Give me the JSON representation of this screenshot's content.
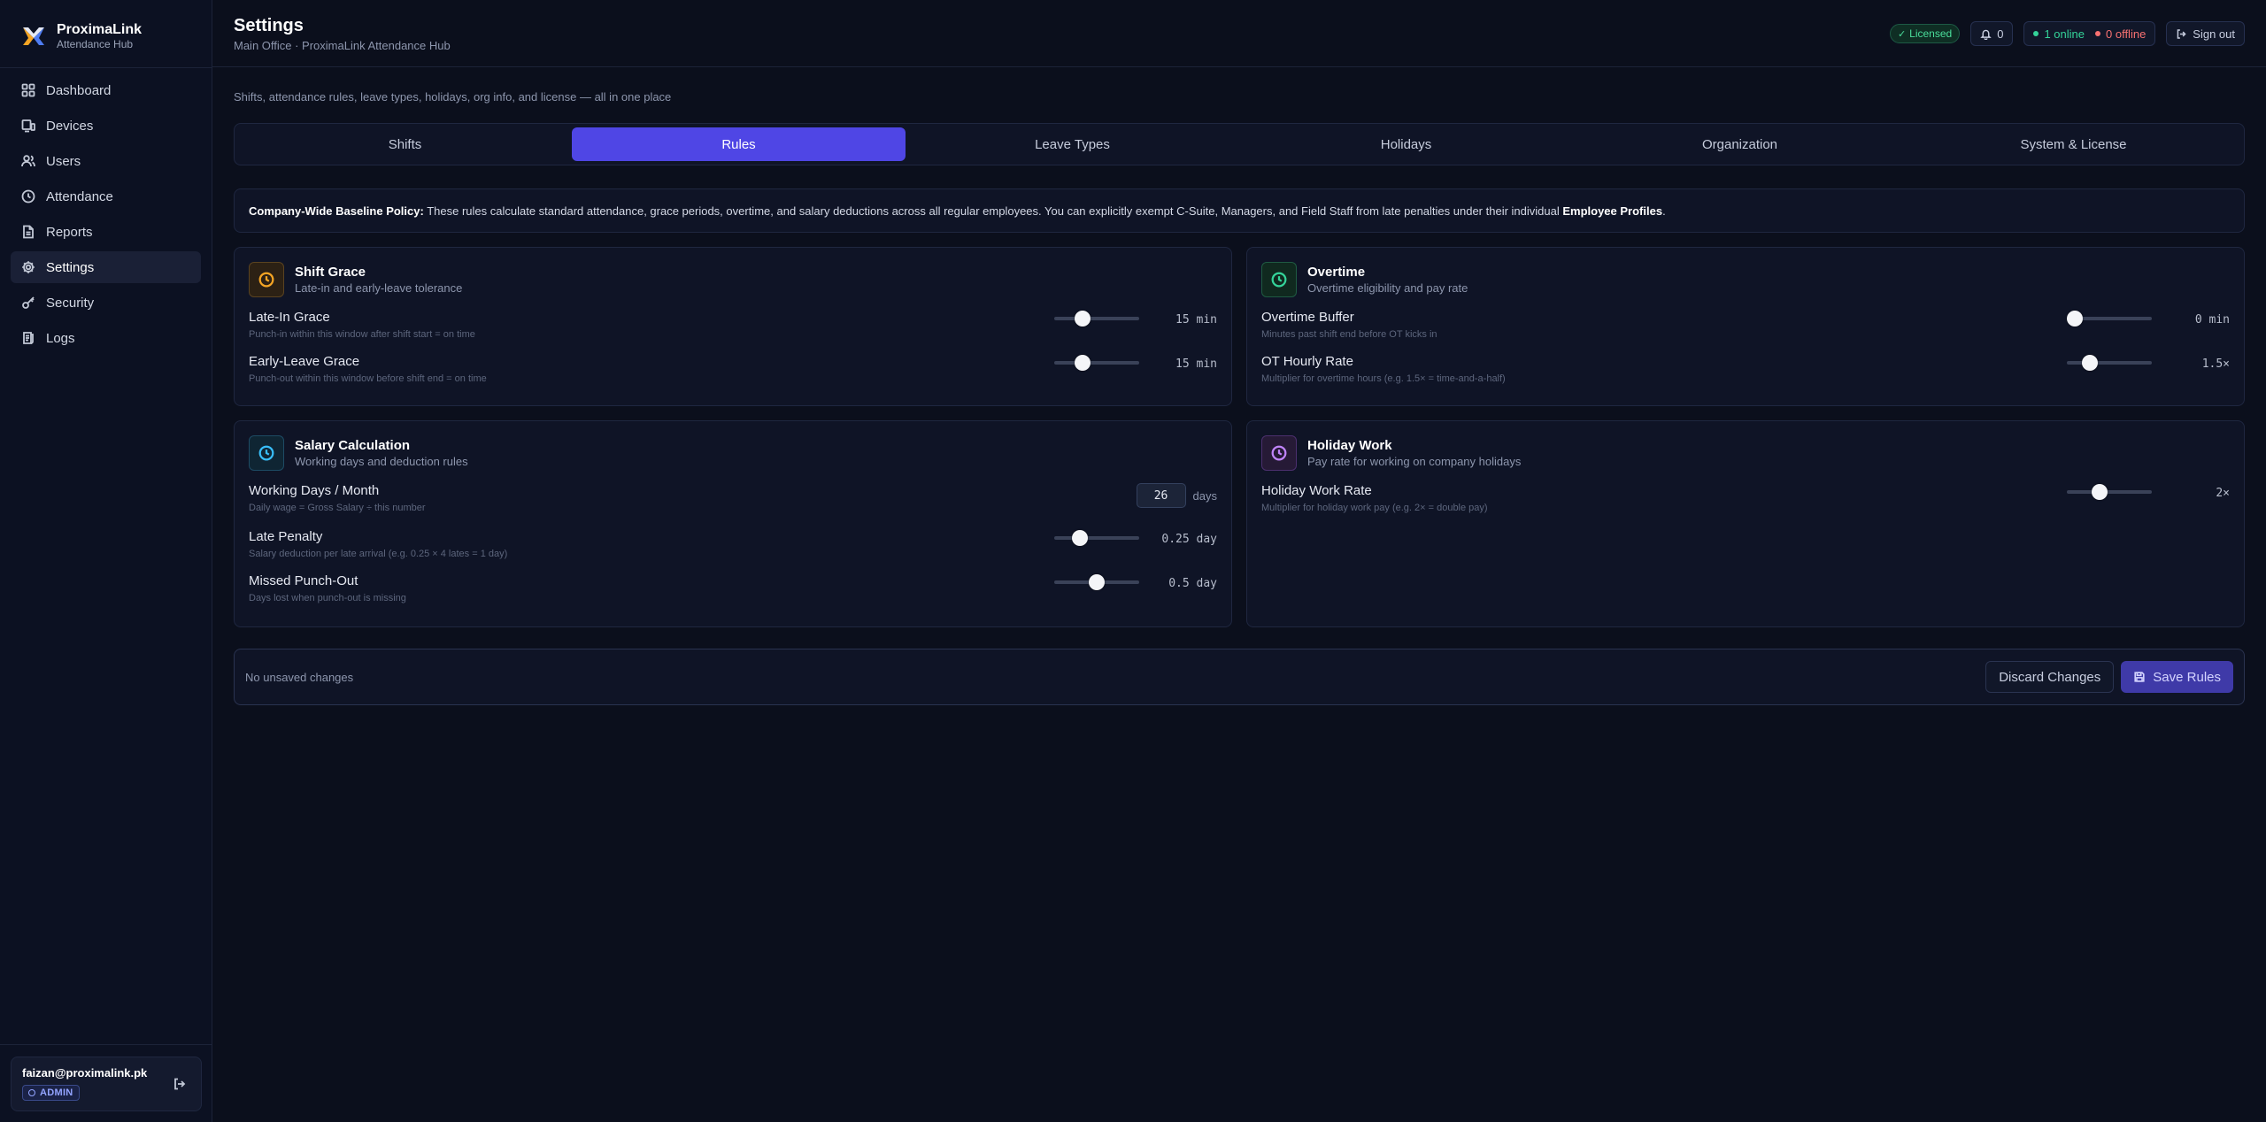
{
  "brand": {
    "name": "ProximaLink",
    "subtitle": "Attendance Hub"
  },
  "nav": [
    {
      "label": "Dashboard",
      "icon": "grid-icon"
    },
    {
      "label": "Devices",
      "icon": "device-icon"
    },
    {
      "label": "Users",
      "icon": "users-icon"
    },
    {
      "label": "Attendance",
      "icon": "clock-icon"
    },
    {
      "label": "Reports",
      "icon": "file-icon"
    },
    {
      "label": "Settings",
      "icon": "gear-icon",
      "active": true
    },
    {
      "label": "Security",
      "icon": "key-icon"
    },
    {
      "label": "Logs",
      "icon": "logs-icon"
    }
  ],
  "user": {
    "email": "faizan@proximalink.pk",
    "role": "ADMIN"
  },
  "header": {
    "title": "Settings",
    "subtitle": "Main Office · ProximaLink Attendance Hub",
    "license": "Licensed",
    "notifications": "0",
    "online": "1 online",
    "offline": "0 offline",
    "signout": "Sign out"
  },
  "description": "Shifts, attendance rules, leave types, holidays, org info, and license — all in one place",
  "tabs": [
    {
      "label": "Shifts"
    },
    {
      "label": "Rules",
      "active": true
    },
    {
      "label": "Leave Types"
    },
    {
      "label": "Holidays"
    },
    {
      "label": "Organization"
    },
    {
      "label": "System & License"
    }
  ],
  "policy": {
    "lead": "Company-Wide Baseline Policy:",
    "text": " These rules calculate standard attendance, grace periods, overtime, and salary deductions across all regular employees. You can explicitly exempt C-Suite, Managers, and Field Staff from late penalties under their individual ",
    "link": "Employee Profiles",
    "tail": "."
  },
  "cards": {
    "shift_grace": {
      "title": "Shift Grace",
      "subtitle": "Late-in and early-leave tolerance",
      "accent": "#f5a524",
      "rows": [
        {
          "label": "Late-In Grace",
          "help": "Punch-in within this window after shift start = on time",
          "value": "15 min",
          "fraction": 0.3
        },
        {
          "label": "Early-Leave Grace",
          "help": "Punch-out within this window before shift end = on time",
          "value": "15 min",
          "fraction": 0.3
        }
      ]
    },
    "overtime": {
      "title": "Overtime",
      "subtitle": "Overtime eligibility and pay rate",
      "accent": "#34d399",
      "rows": [
        {
          "label": "Overtime Buffer",
          "help": "Minutes past shift end before OT kicks in",
          "value": "0 min",
          "fraction": 0.0
        },
        {
          "label": "OT Hourly Rate",
          "help": "Multiplier for overtime hours (e.g. 1.5× = time-and-a-half)",
          "value": "1.5×",
          "fraction": 0.22
        }
      ]
    },
    "salary": {
      "title": "Salary Calculation",
      "subtitle": "Working days and deduction rules",
      "accent": "#38bdf8",
      "working_days": {
        "label": "Working Days / Month",
        "help": "Daily wage = Gross Salary ÷ this number",
        "value": "26",
        "unit": "days"
      },
      "rows": [
        {
          "label": "Late Penalty",
          "help": "Salary deduction per late arrival (e.g. 0.25 × 4 lates = 1 day)",
          "value": "0.25 day",
          "fraction": 0.25
        },
        {
          "label": "Missed Punch-Out",
          "help": "Days lost when punch-out is missing",
          "value": "0.5 day",
          "fraction": 0.5
        }
      ]
    },
    "holiday": {
      "title": "Holiday Work",
      "subtitle": "Pay rate for working on company holidays",
      "accent": "#c084fc",
      "rows": [
        {
          "label": "Holiday Work Rate",
          "help": "Multiplier for holiday work pay (e.g. 2× = double pay)",
          "value": "2×",
          "fraction": 0.36
        }
      ]
    }
  },
  "footer": {
    "status": "No unsaved changes",
    "discard": "Discard Changes",
    "save": "Save Rules"
  }
}
